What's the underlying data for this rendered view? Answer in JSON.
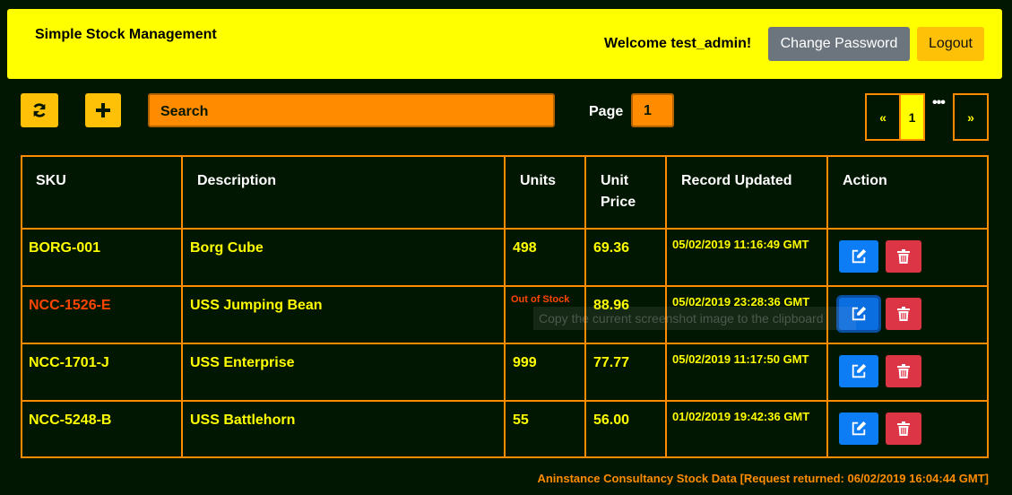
{
  "header": {
    "app_title": "Simple Stock Management",
    "welcome": "Welcome test_admin!",
    "change_password": "Change Password",
    "logout": "Logout"
  },
  "toolbar": {
    "refresh_icon": "refresh-icon",
    "add_icon": "plus-icon",
    "search_value": "Search",
    "page_label": "Page",
    "page_value": "1"
  },
  "pagination": {
    "prev": "«",
    "current": "1",
    "more": "•••",
    "next": "»"
  },
  "table": {
    "headers": [
      "SKU",
      "Description",
      "Units",
      "Unit Price",
      "Record Updated",
      "Action"
    ],
    "rows": [
      {
        "sku": "BORG-001",
        "description": "Borg Cube",
        "units": "498",
        "price": "69.36",
        "updated": "05/02/2019 11:16:49 GMT",
        "status": ""
      },
      {
        "sku": "NCC-1526-E",
        "description": "USS Jumping Bean",
        "units": "",
        "price": "88.96",
        "updated": "05/02/2019 23:28:36 GMT",
        "status": "Out of Stock"
      },
      {
        "sku": "NCC-1701-J",
        "description": "USS Enterprise",
        "units": "999",
        "price": "77.77",
        "updated": "05/02/2019 11:17:50 GMT",
        "status": ""
      },
      {
        "sku": "NCC-5248-B",
        "description": "USS Battlehorn",
        "units": "55",
        "price": "56.00",
        "updated": "01/02/2019 19:42:36 GMT",
        "status": ""
      }
    ]
  },
  "tooltip": "Copy the current screenshot image to the clipboard",
  "footer": "Aninstance Consultancy Stock Data [Request returned: 06/02/2019 16:04:44 GMT]",
  "colors": {
    "background": "#021702",
    "header": "#ffff00",
    "accent": "#ff8c00",
    "warning": "#ffc107",
    "edit": "#0d7df5",
    "delete": "#dc3545",
    "out_of_stock": "#ff4500"
  }
}
